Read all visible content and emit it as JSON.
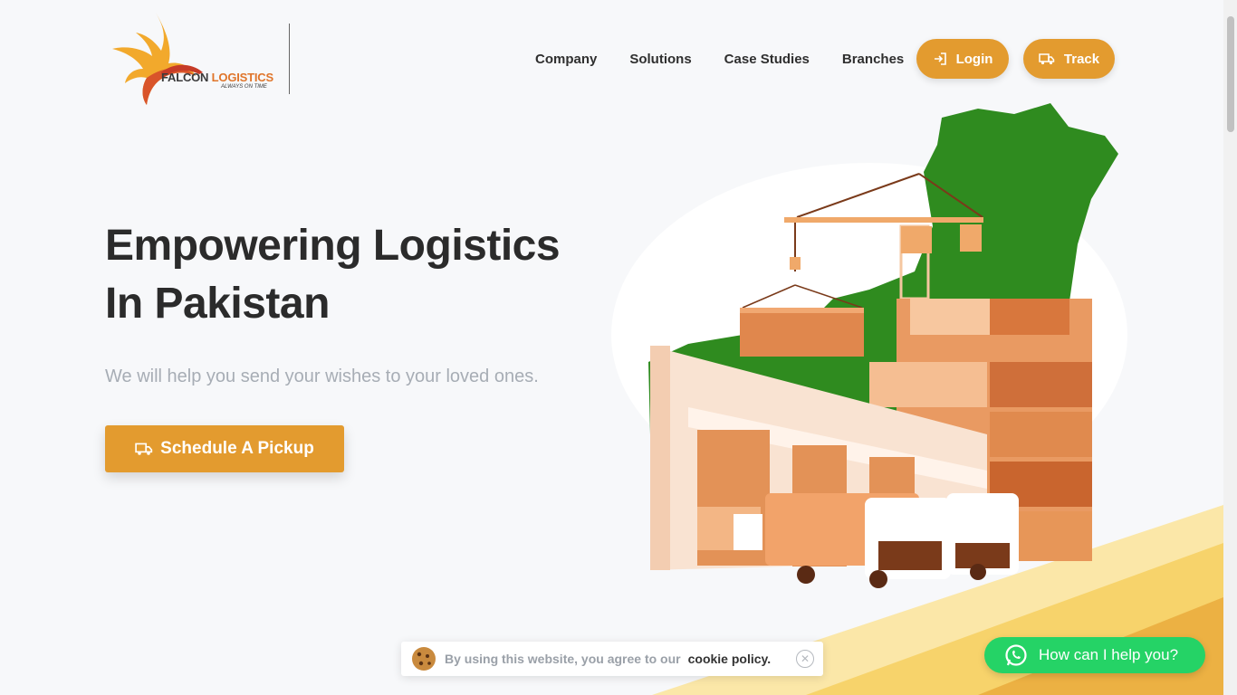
{
  "header": {
    "logo": {
      "brand_primary": "FALCON",
      "brand_accent": "LOGISTICS",
      "tagline": "ALWAYS ON TIME"
    },
    "nav": [
      {
        "label": "Company"
      },
      {
        "label": "Solutions"
      },
      {
        "label": "Case Studies"
      },
      {
        "label": "Branches"
      }
    ],
    "login_label": "Login",
    "track_label": "Track"
  },
  "hero": {
    "title_line1": "Empowering Logistics",
    "title_line2": "In Pakistan",
    "subtitle": "We will help you send your wishes to your loved ones.",
    "cta_label": "Schedule A Pickup"
  },
  "cookie": {
    "text": "By using this website, you agree to our",
    "link": "cookie policy."
  },
  "whatsapp": {
    "label": "How can I help you?"
  },
  "colors": {
    "accent": "#e39b2f",
    "green_map": "#2f8b1f",
    "whatsapp": "#25d366",
    "heading": "#2b2b2b",
    "subtitle": "#a7adb5"
  },
  "icons": [
    "login-icon",
    "truck-icon",
    "cookie-icon",
    "close-icon",
    "whatsapp-icon"
  ]
}
